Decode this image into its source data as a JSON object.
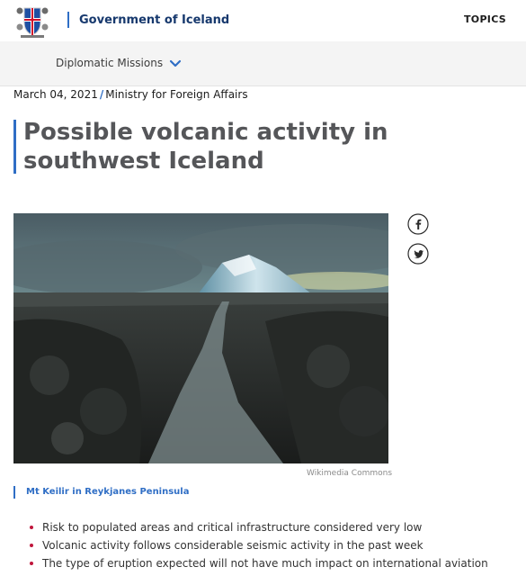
{
  "header": {
    "site_name": "Government of Iceland",
    "topics_label": "TOPICS",
    "logo_icon": "iceland-coat-of-arms"
  },
  "subnav": {
    "label": "Diplomatic Missions",
    "chevron_icon": "chevron-down-icon"
  },
  "article": {
    "date": "March 04, 2021",
    "separator": "/",
    "ministry": "Ministry for Foreign Affairs",
    "title": "Possible volcanic activity in southwest Iceland",
    "image_credit": "Wikimedia Commons",
    "image_caption": "Mt Keilir in Reykjanes Peninsula",
    "bullets": [
      "Risk to populated areas and critical infrastructure considered very low",
      "Volcanic activity follows considerable seismic activity in the past week",
      "The type of eruption expected will not have much impact on international aviation"
    ]
  },
  "share": [
    "facebook-icon",
    "twitter-icon"
  ],
  "colors": {
    "brand_blue": "#16386d",
    "accent_blue": "#2f6ec5",
    "bullet_red": "#c0163c",
    "title_gray": "#555659"
  }
}
